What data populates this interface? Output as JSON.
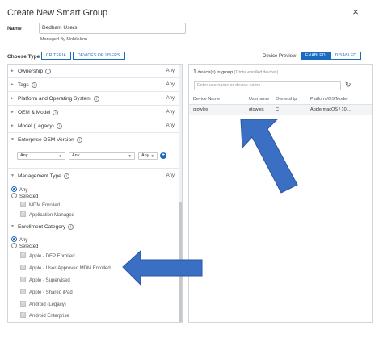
{
  "dialog": {
    "title": "Create New Smart Group",
    "close_glyph": "×"
  },
  "name_field": {
    "label": "Name",
    "value": "Dedham Users",
    "managed_by": "Managed By MobileIron"
  },
  "choose_type": {
    "label": "Choose Type",
    "options": [
      "CRITERIA",
      "DEVICES OR USERS"
    ],
    "selected": "CRITERIA"
  },
  "device_preview": {
    "label": "Device Preview",
    "options": [
      "ENABLED",
      "DISABLED"
    ],
    "selected": "ENABLED"
  },
  "criteria": {
    "collapsed_rows": [
      {
        "label": "Ownership",
        "info": true,
        "value": "Any"
      },
      {
        "label": "Tags",
        "info": true,
        "value": "Any"
      },
      {
        "label": "Platform and Operating System",
        "info": true,
        "value": "Any"
      },
      {
        "label": "OEM & Model",
        "info": true,
        "value": "Any"
      },
      {
        "label": "Model (Legacy)",
        "info": true,
        "value": "Any"
      }
    ],
    "enterprise_oem": {
      "label": "Enterprise OEM Version",
      "selects": [
        "Any",
        "Any",
        "Any"
      ]
    },
    "management_type": {
      "label": "Management Type",
      "value": "Any",
      "radios": [
        "Any",
        "Selected"
      ],
      "selected_radio": "Any",
      "checkboxes": [
        "MDM Enrolled",
        "Application Managed"
      ]
    },
    "enrollment_category": {
      "label": "Enrollment Category",
      "radios": [
        "Any",
        "Selected"
      ],
      "selected_radio": "Any",
      "checkboxes": [
        "Apple - DEP Enrolled",
        "Apple - User-Approved MDM Enrolled",
        "Apple - Supervised",
        "Apple - Shared iPad",
        "Android (Legacy)",
        "Android Enterprise"
      ]
    }
  },
  "preview": {
    "count": "1",
    "count_suffix": "device(s) in group",
    "count_note": "(1 total enrolled devices)",
    "search_placeholder": "Enter username or device name",
    "refresh_glyph": "↻",
    "columns": [
      "Device Name",
      "Username",
      "Ownership",
      "Platform/OS/Model"
    ],
    "rows": [
      [
        "gtowles",
        "gtowles",
        "C",
        "Apple macOS / 10...."
      ]
    ]
  },
  "annotation_color": "#3b6fc4"
}
